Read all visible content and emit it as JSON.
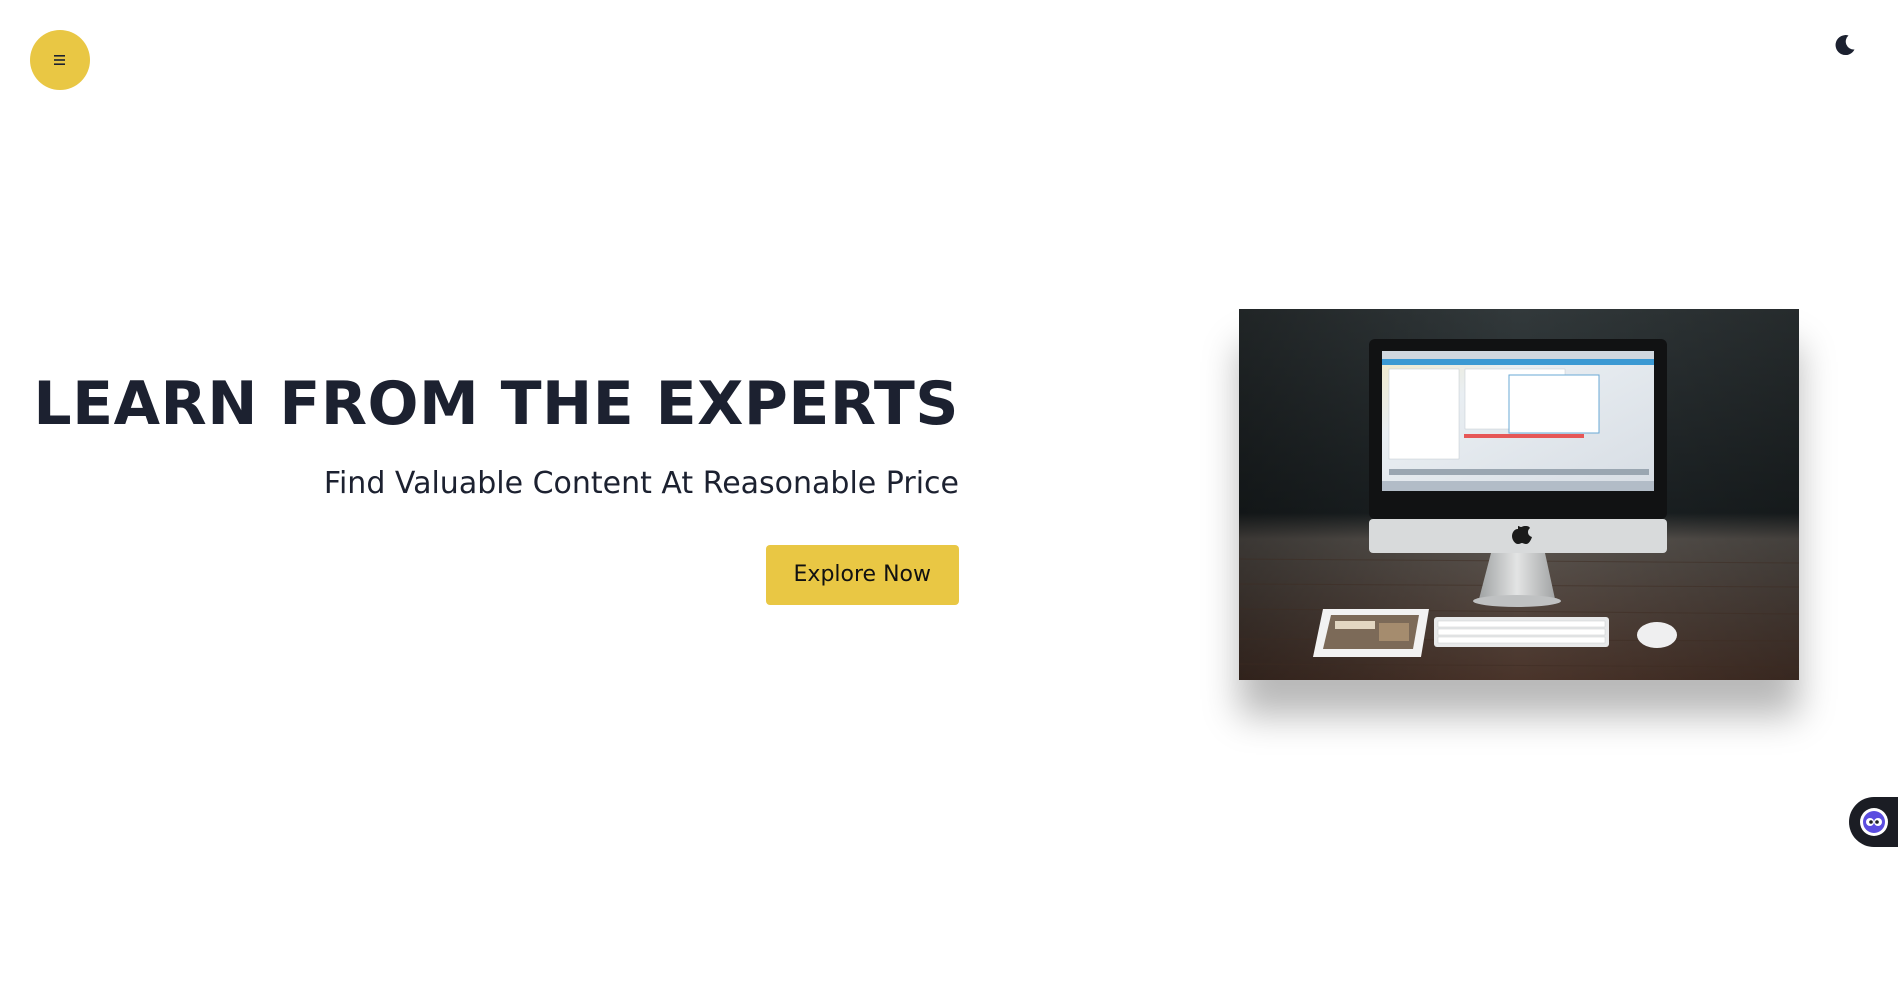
{
  "header": {
    "menu_icon": "menu-icon",
    "theme_toggle_icon": "moon-icon"
  },
  "hero": {
    "title": "LEARN FROM THE EXPERTS",
    "subtitle": "Find Valuable Content At Reasonable Price",
    "cta_label": "Explore Now",
    "image_icon": "desktop-computer-photo"
  },
  "chat_widget": {
    "icon": "chat-bot-icon"
  },
  "colors": {
    "accent": "#e9c744",
    "heading": "#1c2130",
    "background": "#ffffff",
    "widget_bg": "#1b1d24"
  }
}
